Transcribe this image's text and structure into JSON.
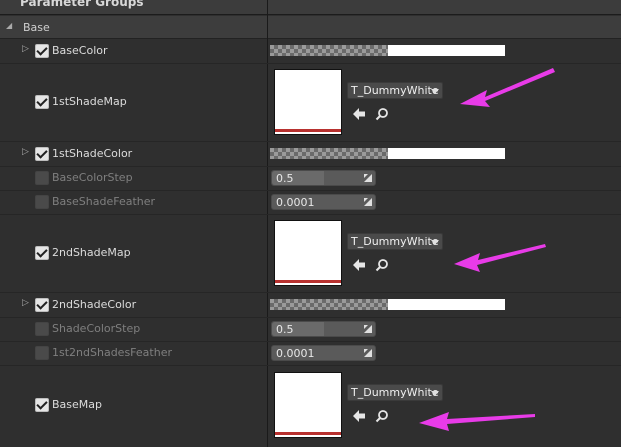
{
  "panel": {
    "group_title": "Parameter Groups",
    "section_title": "Base"
  },
  "params": [
    {
      "id": "basecolor",
      "label": "BaseColor",
      "type": "color",
      "enabled": true,
      "expandable": true
    },
    {
      "id": "1stshademap",
      "label": "1stShadeMap",
      "type": "texture",
      "enabled": true,
      "expandable": false,
      "asset": "T_DummyWhite"
    },
    {
      "id": "1stshadecolor",
      "label": "1stShadeColor",
      "type": "color",
      "enabled": true,
      "expandable": true
    },
    {
      "id": "basecolorstep",
      "label": "BaseColorStep",
      "type": "scalar",
      "enabled": false,
      "expandable": false,
      "value": "0.5",
      "fill": 0.5
    },
    {
      "id": "baseshadefeather",
      "label": "BaseShadeFeather",
      "type": "scalar",
      "enabled": false,
      "expandable": false,
      "value": "0.0001",
      "fill": 0.0
    },
    {
      "id": "2ndshademap",
      "label": "2ndShadeMap",
      "type": "texture",
      "enabled": true,
      "expandable": false,
      "asset": "T_DummyWhite"
    },
    {
      "id": "2ndshadecolor",
      "label": "2ndShadeColor",
      "type": "color",
      "enabled": true,
      "expandable": true
    },
    {
      "id": "shadecolorstep",
      "label": "ShadeColorStep",
      "type": "scalar",
      "enabled": false,
      "expandable": false,
      "value": "0.5",
      "fill": 0.5
    },
    {
      "id": "1st2ndshadesfeather",
      "label": "1st2ndShadesFeather",
      "type": "scalar",
      "enabled": false,
      "expandable": false,
      "value": "0.0001",
      "fill": 0.0
    },
    {
      "id": "basemap",
      "label": "BaseMap",
      "type": "texture",
      "enabled": true,
      "expandable": false,
      "asset": "T_DummyWhite"
    }
  ],
  "colors": {
    "annotation_arrow": "#e83be8",
    "texture_redline": "#b8312f"
  },
  "icons": {
    "expander": "expand-triangle-icon",
    "use_asset": "use-selected-arrow-icon",
    "browse": "browse-magnifier-icon",
    "scalar_drag": "resize-drag-icon"
  }
}
